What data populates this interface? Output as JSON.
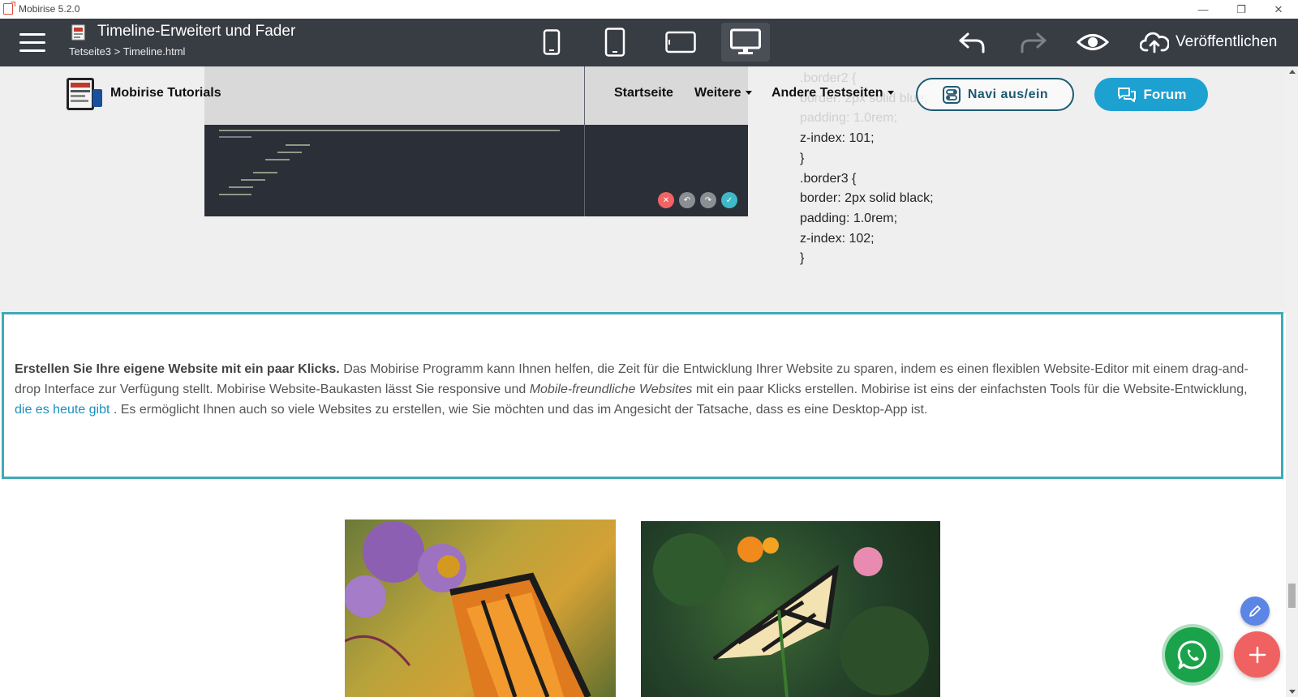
{
  "window": {
    "title": "Mobirise 5.2.0"
  },
  "toolbar": {
    "page_title": "Timeline-Erweitert und Fader",
    "page_path": "Tetseite3 > Timeline.html",
    "publish_label": "Veröffentlichen",
    "active_device": "desktop"
  },
  "site": {
    "brand": "Mobirise Tutorials",
    "nav": {
      "startseite": "Startseite",
      "weitere": "Weitere",
      "andere": "Andere Testseiten"
    },
    "btn_navi": "Navi aus/ein",
    "btn_forum": "Forum"
  },
  "css_code": {
    "line1": ".border2 {",
    "line2": "border: 2px solid blue;",
    "line3": "padding: 1.0rem;",
    "line4": "z-index: 101;",
    "line5": "}",
    "line6": ".border3 {",
    "line7": "border: 2px solid black;",
    "line8": "padding: 1.0rem;",
    "line9": "z-index: 102;",
    "line10": "}"
  },
  "text_block": {
    "bold": "Erstellen Sie Ihre eigene Website mit ein paar Klicks.",
    "part1": " Das Mobirise Programm kann Ihnen helfen, die Zeit für die Entwicklung Ihrer Website zu sparen, indem es einen flexiblen Website-Editor mit einem drag-and-drop Interface zur Verfügung stellt. Mobirise Website-Baukasten lässt Sie responsive und ",
    "italic": "Mobile-freundliche Websites",
    "part2": " mit ein paar Klicks erstellen. Mobirise ist eins der einfachsten Tools für die Website-Entwicklung, ",
    "link": "die es heute gibt",
    "part3": " . Es ermöglicht Ihnen auch so viele Websites zu erstellen, wie Sie möchten und das im Angesicht der Tatsache, dass es eine Desktop-App ist."
  },
  "colors": {
    "toolbar_bg": "#383c43",
    "accent": "#42a9b6",
    "forum_bg": "#1da1d1",
    "fab_add": "#f06262",
    "fab_edit": "#5b86e6",
    "whatsapp": "#1aa34a"
  }
}
